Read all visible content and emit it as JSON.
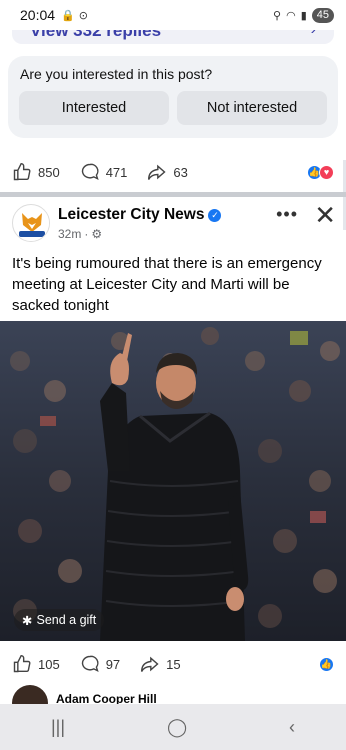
{
  "status_bar": {
    "time": "20:04",
    "battery": "45"
  },
  "replies": {
    "label": "View 332 replies"
  },
  "interest_card": {
    "question": "Are you interested in this post?",
    "interested_label": "Interested",
    "not_interested_label": "Not interested"
  },
  "prev_post_reactions": {
    "likes": "850",
    "comments": "471",
    "shares": "63"
  },
  "post": {
    "page_name": "Leicester City News",
    "time": "32m",
    "text": "It's being rumoured that there is an emergency meeting at Leicester City and Marti will be sacked tonight",
    "send_gift_label": "Send a gift",
    "likes": "105",
    "comments": "97",
    "shares": "15"
  },
  "next_post": {
    "author": "Adam Cooper Hill"
  },
  "colors": {
    "accent": "#1877f2",
    "love": "#f33e58"
  }
}
